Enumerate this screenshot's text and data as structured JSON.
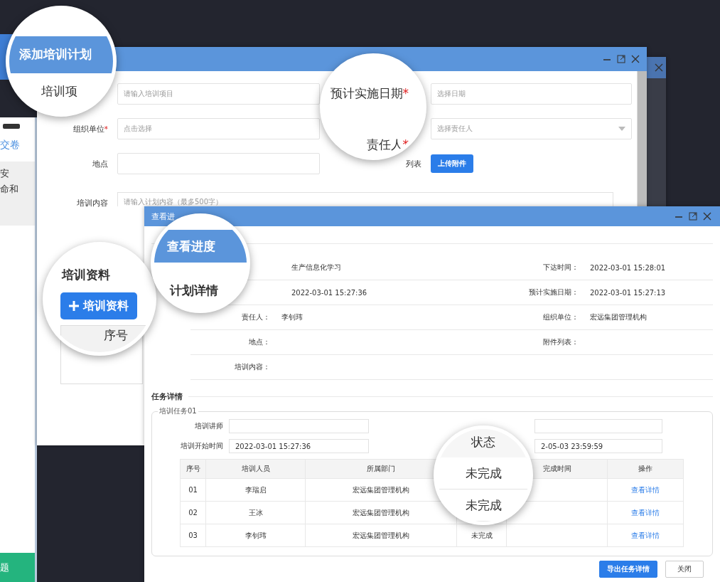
{
  "back_panel": {
    "link": "交卷",
    "lines": [
      "安",
      "命和"
    ],
    "footer": "题"
  },
  "plan_window": {
    "rows": [
      {
        "fields": [
          {
            "kind": "input",
            "placeholder": "请输入培训项目"
          },
          {
            "kind": "input",
            "placeholder": "选择日期"
          }
        ]
      },
      {
        "fields": [
          {
            "kind": "input",
            "label": "组织单位",
            "mark": "*",
            "placeholder": "点击选择"
          },
          {
            "kind": "select",
            "placeholder": "选择责任人"
          }
        ]
      },
      {
        "fields": [
          {
            "kind": "input",
            "label": "地点"
          },
          {
            "kind": "upload",
            "label": "列表",
            "button": "上传附件"
          }
        ]
      }
    ],
    "content": {
      "label": "培训内容",
      "placeholder": "请输入计划内容（最多500字）"
    }
  },
  "progress_window": {
    "title": "查看进",
    "details": [
      {
        "value": "生产信息化学习",
        "right_label": "下达时间：",
        "right_value": "2022-03-01 15:28:01"
      },
      {
        "value": "2022-03-01 15:27:36",
        "right_label": "预计实施日期：",
        "right_value": "2022-03-01 15:27:13"
      },
      {
        "label": "责任人：",
        "value": "李钊玮",
        "right_label": "组织单位：",
        "right_value": "宏远集团管理机构"
      },
      {
        "label": "地点：",
        "right_label": "附件列表："
      },
      {
        "label": "培训内容："
      }
    ],
    "task_heading": "任务详情",
    "task": {
      "legend": "培训任务01",
      "teacher_label": "培训讲师",
      "start_label": "培训开始时间",
      "start_value": "2022-03-01 15:27:36",
      "end_value": "2-05-03 23:59:59",
      "columns": [
        {
          "label": "序号"
        },
        {
          "label": "培训人员"
        },
        {
          "label": "所属部门"
        },
        {},
        {
          "label": "完成时间"
        },
        {
          "label": "操作"
        }
      ],
      "rows": [
        {
          "no": "01",
          "name": "李瑞启",
          "dept": "宏远集团管理机构",
          "action": "查看详情"
        },
        {
          "no": "02",
          "name": "王冰",
          "dept": "宏远集团管理机构",
          "action": "查看详情"
        },
        {
          "no": "03",
          "name": "李钊玮",
          "dept": "宏远集团管理机构",
          "status": "未完成",
          "action": "查看详情"
        }
      ]
    },
    "buttons": [
      {
        "kind": "primary",
        "label": "导出任务详情"
      },
      {
        "kind": "default",
        "label": "关闭"
      }
    ]
  },
  "magnifiers": [
    {
      "kind": "title",
      "title": "添加培训计划",
      "label": "培训项"
    },
    {
      "kind": "labels",
      "labels": [
        {
          "text": "预计实施日期",
          "mark": "*"
        },
        {
          "text": "责任人",
          "mark": "*"
        }
      ]
    },
    {
      "kind": "materials",
      "heading": "培训资料",
      "button": "培训资料",
      "column": "序号"
    },
    {
      "kind": "progress",
      "title": "查看进度",
      "heading": "计划详情"
    },
    {
      "kind": "status",
      "header": "状态",
      "cells": [
        "未完成",
        "未完成"
      ]
    }
  ]
}
